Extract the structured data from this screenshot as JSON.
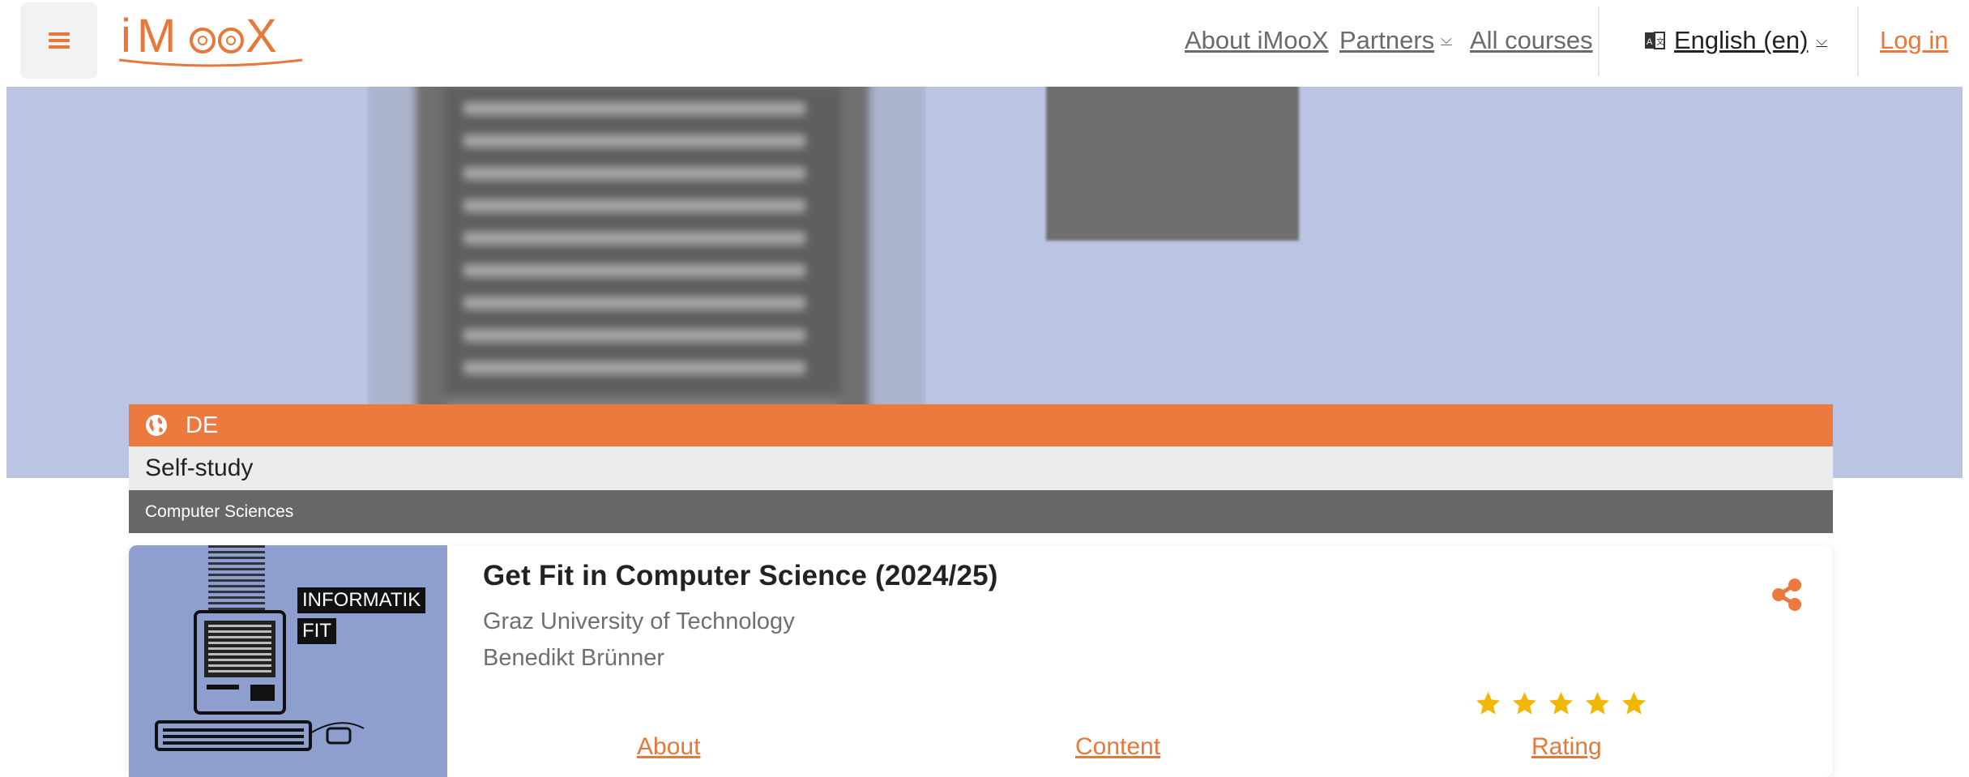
{
  "navbar": {
    "logo_text": "iMooX",
    "about_label": "About iMooX",
    "partners_label": "Partners",
    "all_courses_label": "All courses",
    "language_label": "English (en)",
    "login_label": "Log in"
  },
  "course": {
    "language": "DE",
    "mode": "Self-study",
    "category": "Computer Sciences",
    "thumbnail_labels": [
      "INFORMATIK",
      "FIT"
    ],
    "title": "Get Fit in Computer Science (2024/25)",
    "university": "Graz University of Technology",
    "author": "Benedikt Brünner",
    "rating_stars": 5,
    "tabs": [
      {
        "label": "About"
      },
      {
        "label": "Content"
      },
      {
        "label": "Rating"
      }
    ]
  },
  "icons": {
    "menu": "hamburger-icon",
    "partners_dropdown": "chevron-down-icon",
    "language": "language-book-icon",
    "language_dropdown": "chevron-down-icon",
    "globe": "globe-icon",
    "share": "share-icon",
    "star": "star-icon"
  },
  "colors": {
    "accent": "#ec7a3f",
    "hero_bg": "#bbc4e3",
    "category_bg": "#676767",
    "mode_bg": "#ececec",
    "star": "#f2b705",
    "thumbnail_bg": "#8e9ecf"
  }
}
